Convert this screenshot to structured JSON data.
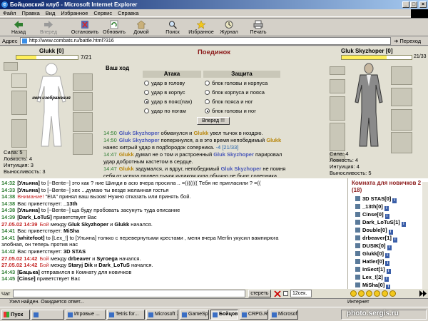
{
  "window": {
    "title": "Бойцовский клуб - Microsoft Internet Explorer"
  },
  "menu": [
    "Файл",
    "Правка",
    "Вид",
    "Избранное",
    "Сервис",
    "Справка"
  ],
  "toolbar": [
    {
      "label": "Назад",
      "icon": "back-arrow-icon"
    },
    {
      "label": "Вперед",
      "icon": "forward-arrow-icon"
    },
    {
      "label": "Остановить",
      "icon": "stop-icon"
    },
    {
      "label": "Обновить",
      "icon": "refresh-icon"
    },
    {
      "label": "Домой",
      "icon": "home-icon"
    },
    {
      "label": "Поиск",
      "icon": "search-icon"
    },
    {
      "label": "Избранное",
      "icon": "favorites-icon"
    },
    {
      "label": "Журнал",
      "icon": "history-icon"
    },
    {
      "label": "Печать",
      "icon": "print-icon"
    }
  ],
  "address": {
    "label": "Адрес",
    "url": "http://www.combats.ru/battle.html?316",
    "go": "Переход"
  },
  "battle": {
    "title": "Поединок",
    "your_move": "Ваш ход",
    "left": {
      "name": "Glukk",
      "level": "[0]",
      "hp": "7/21",
      "hp_fraction": 0.33,
      "placeholder": "нет изображения",
      "stats": [
        "Сила: 5",
        "Ловкость: 4",
        "Интуиция: 3",
        "Выносливость: 3"
      ]
    },
    "right": {
      "name": "Gluk Skyzhoper",
      "level": "[0]",
      "hp": "21/33",
      "hp_fraction": 0.64,
      "stats": [
        "Сила: 4",
        "Ловкость: 4",
        "Интуиция: 4",
        "Выносливость: 5"
      ]
    },
    "attack_header": "Атака",
    "defense_header": "Защита",
    "attack": [
      "удар в голову",
      "удар в корпус",
      "удар в пояс(пах)",
      "удар по ногам"
    ],
    "defense": [
      "блок головы и корпуса",
      "блок корпуса и пояса",
      "блок пояса и ног",
      "блок головы и ног"
    ],
    "attack_selected": 2,
    "defense_selected": 3,
    "forward_button": "Вперед !!!",
    "log": [
      {
        "time": "14:50",
        "p": "Gluk Skyzhoper",
        "c": "pb",
        "t": " обманулся и ",
        "p2": "Glukk",
        "c2": "py",
        "t2": " увел тычок в ноздрю."
      },
      {
        "time": "14:50",
        "p": "Gluk Skyzhoper",
        "c": "pb",
        "t": " поперхнулся, а в это время непобедимый ",
        "p2": "Glukk",
        "c2": "py",
        "t2": ""
      },
      {
        "time": "",
        "p": "",
        "c": "",
        "t": "нанес хитрый удар в подбородок соперника. ",
        "p2": "-4 [21/33]",
        "c2": "dmg",
        "t2": ""
      },
      {
        "time": "14:47",
        "p": "Glukk",
        "c": "py",
        "t": " думал не о том и растроенный ",
        "p2": "Gluk Skyzhoper",
        "c2": "pb",
        "t2": " парировал"
      },
      {
        "time": "",
        "p": "",
        "c": "",
        "t": "удар добротным кастетом в сердце.",
        "p2": "",
        "c2": "",
        "t2": ""
      },
      {
        "time": "14:47",
        "p": "Glukk",
        "c": "py",
        "t": " задумался, и вдруг, непобедимый ",
        "p2": "Gluk Skyzhoper",
        "c2": "pb",
        "t2": " не помня"
      },
      {
        "time": "",
        "p": "",
        "c": "",
        "t": "себя от испуга провел тычок кулаком куда обычно не бьют соперника.",
        "p2": "",
        "c2": "",
        "t2": ""
      }
    ]
  },
  "chat": [
    {
      "time": "14:32",
      "tc": "ct",
      "segs": [
        [
          "[Ульяна]",
          "cbold"
        ],
        [
          " to [~Bente~] это как ? ние Шинди в асю вчера просила .. =((((((( Тебя не пригласили ? =((",
          ""
        ]
      ]
    },
    {
      "time": "14:33",
      "tc": "ct",
      "segs": [
        [
          "[Ульяна]",
          "cbold"
        ],
        [
          " to [~Bente~] хех ...думаю ты везде желанная гостья",
          ""
        ]
      ]
    },
    {
      "time": "14:38",
      "tc": "ct",
      "segs": [
        [
          "Внимание!",
          "cred"
        ],
        [
          " \"EIA\" принял ваш вызов! Нужно отказать или принять бой.",
          ""
        ]
      ]
    },
    {
      "time": "14:38",
      "tc": "ct",
      "segs": [
        [
          "Вас приветствует: ",
          ""
        ],
        [
          "_13th",
          "cbold"
        ]
      ]
    },
    {
      "time": "14:38",
      "tc": "ct",
      "segs": [
        [
          "[Ульяна]",
          "cbold"
        ],
        [
          " to [~Bente~] ща буду пробовать засунуть туда описание",
          ""
        ]
      ]
    },
    {
      "time": "14:39",
      "tc": "ct",
      "segs": [
        [
          "[Dark_LoTuS]",
          "cbold"
        ],
        [
          " приветствует Вас",
          ""
        ]
      ]
    },
    {
      "time": "27.05.02 14:39",
      "tc": "cr",
      "segs": [
        [
          "Бой",
          "cred"
        ],
        [
          " между ",
          ""
        ],
        [
          "Gluk Skyzhoper",
          "cbold"
        ],
        [
          " и ",
          ""
        ],
        [
          "Glukk",
          "cbold"
        ],
        [
          " начался.",
          ""
        ]
      ]
    },
    {
      "time": "14:41",
      "tc": "ct",
      "segs": [
        [
          "Вас приветствует: ",
          ""
        ],
        [
          "MiSha",
          "cbold"
        ]
      ]
    },
    {
      "time": "14:41",
      "tc": "ct",
      "segs": [
        [
          "[whitefoot]",
          "cbold"
        ],
        [
          " to [Lex_!] to [Ульяна] толкко с перевернутыми крестами , меня вчера Merlin укусил вампирюга",
          ""
        ]
      ]
    },
    {
      "time": "",
      "tc": "ct",
      "segs": [
        [
          "злобная, он теперь против нас",
          ""
        ]
      ]
    },
    {
      "time": "14:42",
      "tc": "ct",
      "segs": [
        [
          "Вас приветствует: ",
          ""
        ],
        [
          "3D STAS",
          "cbold"
        ]
      ]
    },
    {
      "time": "27.05.02 14:42",
      "tc": "cr",
      "segs": [
        [
          "Бой",
          "cred"
        ],
        [
          " между ",
          ""
        ],
        [
          "drbeaver",
          "cbold"
        ],
        [
          " и ",
          ""
        ],
        [
          "Syroega",
          "cbold"
        ],
        [
          " начался.",
          ""
        ]
      ]
    },
    {
      "time": "27.05.02 14:42",
      "tc": "cr",
      "segs": [
        [
          "Бой",
          "cred"
        ],
        [
          " между ",
          ""
        ],
        [
          "Staryj Dik",
          "cbold"
        ],
        [
          " и ",
          ""
        ],
        [
          "Dark_LoTuS",
          "cbold"
        ],
        [
          " начался.",
          ""
        ]
      ]
    },
    {
      "time": "14:43",
      "tc": "ct",
      "segs": [
        [
          "[Бацька]",
          "cbold"
        ],
        [
          " отправился в Комнату для новичков",
          ""
        ]
      ]
    },
    {
      "time": "14:45",
      "tc": "ct",
      "segs": [
        [
          "[Cinse]",
          "cbold"
        ],
        [
          " приветствует Вас",
          ""
        ]
      ]
    }
  ],
  "room": {
    "title": "Комната для новичков 2 (18)",
    "users": [
      "3D STAS[0]",
      "_13th[0]",
      "Cinse[0]",
      "Dark_LoTuS[1]",
      "Double[0]",
      "drbeaver[1]",
      "DUSIK[0]",
      "Glukk[0]",
      "Hatler[0]",
      "InSect[1]",
      "Lex_![2]",
      "MiSha[0]"
    ]
  },
  "chat_input": {
    "label": "Чат",
    "send": "стерeть",
    "seconds": "12сек."
  },
  "status": {
    "text": "Узел найден. Ожидается ответ...",
    "zone": "Интернет"
  },
  "taskbar": {
    "start": "Пуск",
    "tasks": [
      "",
      "Игровые ...",
      "Tetris for...",
      "Microsoft ...",
      "GameSpo...",
      "Бойцов...",
      "CRPG.RU...",
      "Microsof..."
    ],
    "active": 5
  },
  "watermark": "photo.sergis.ru"
}
